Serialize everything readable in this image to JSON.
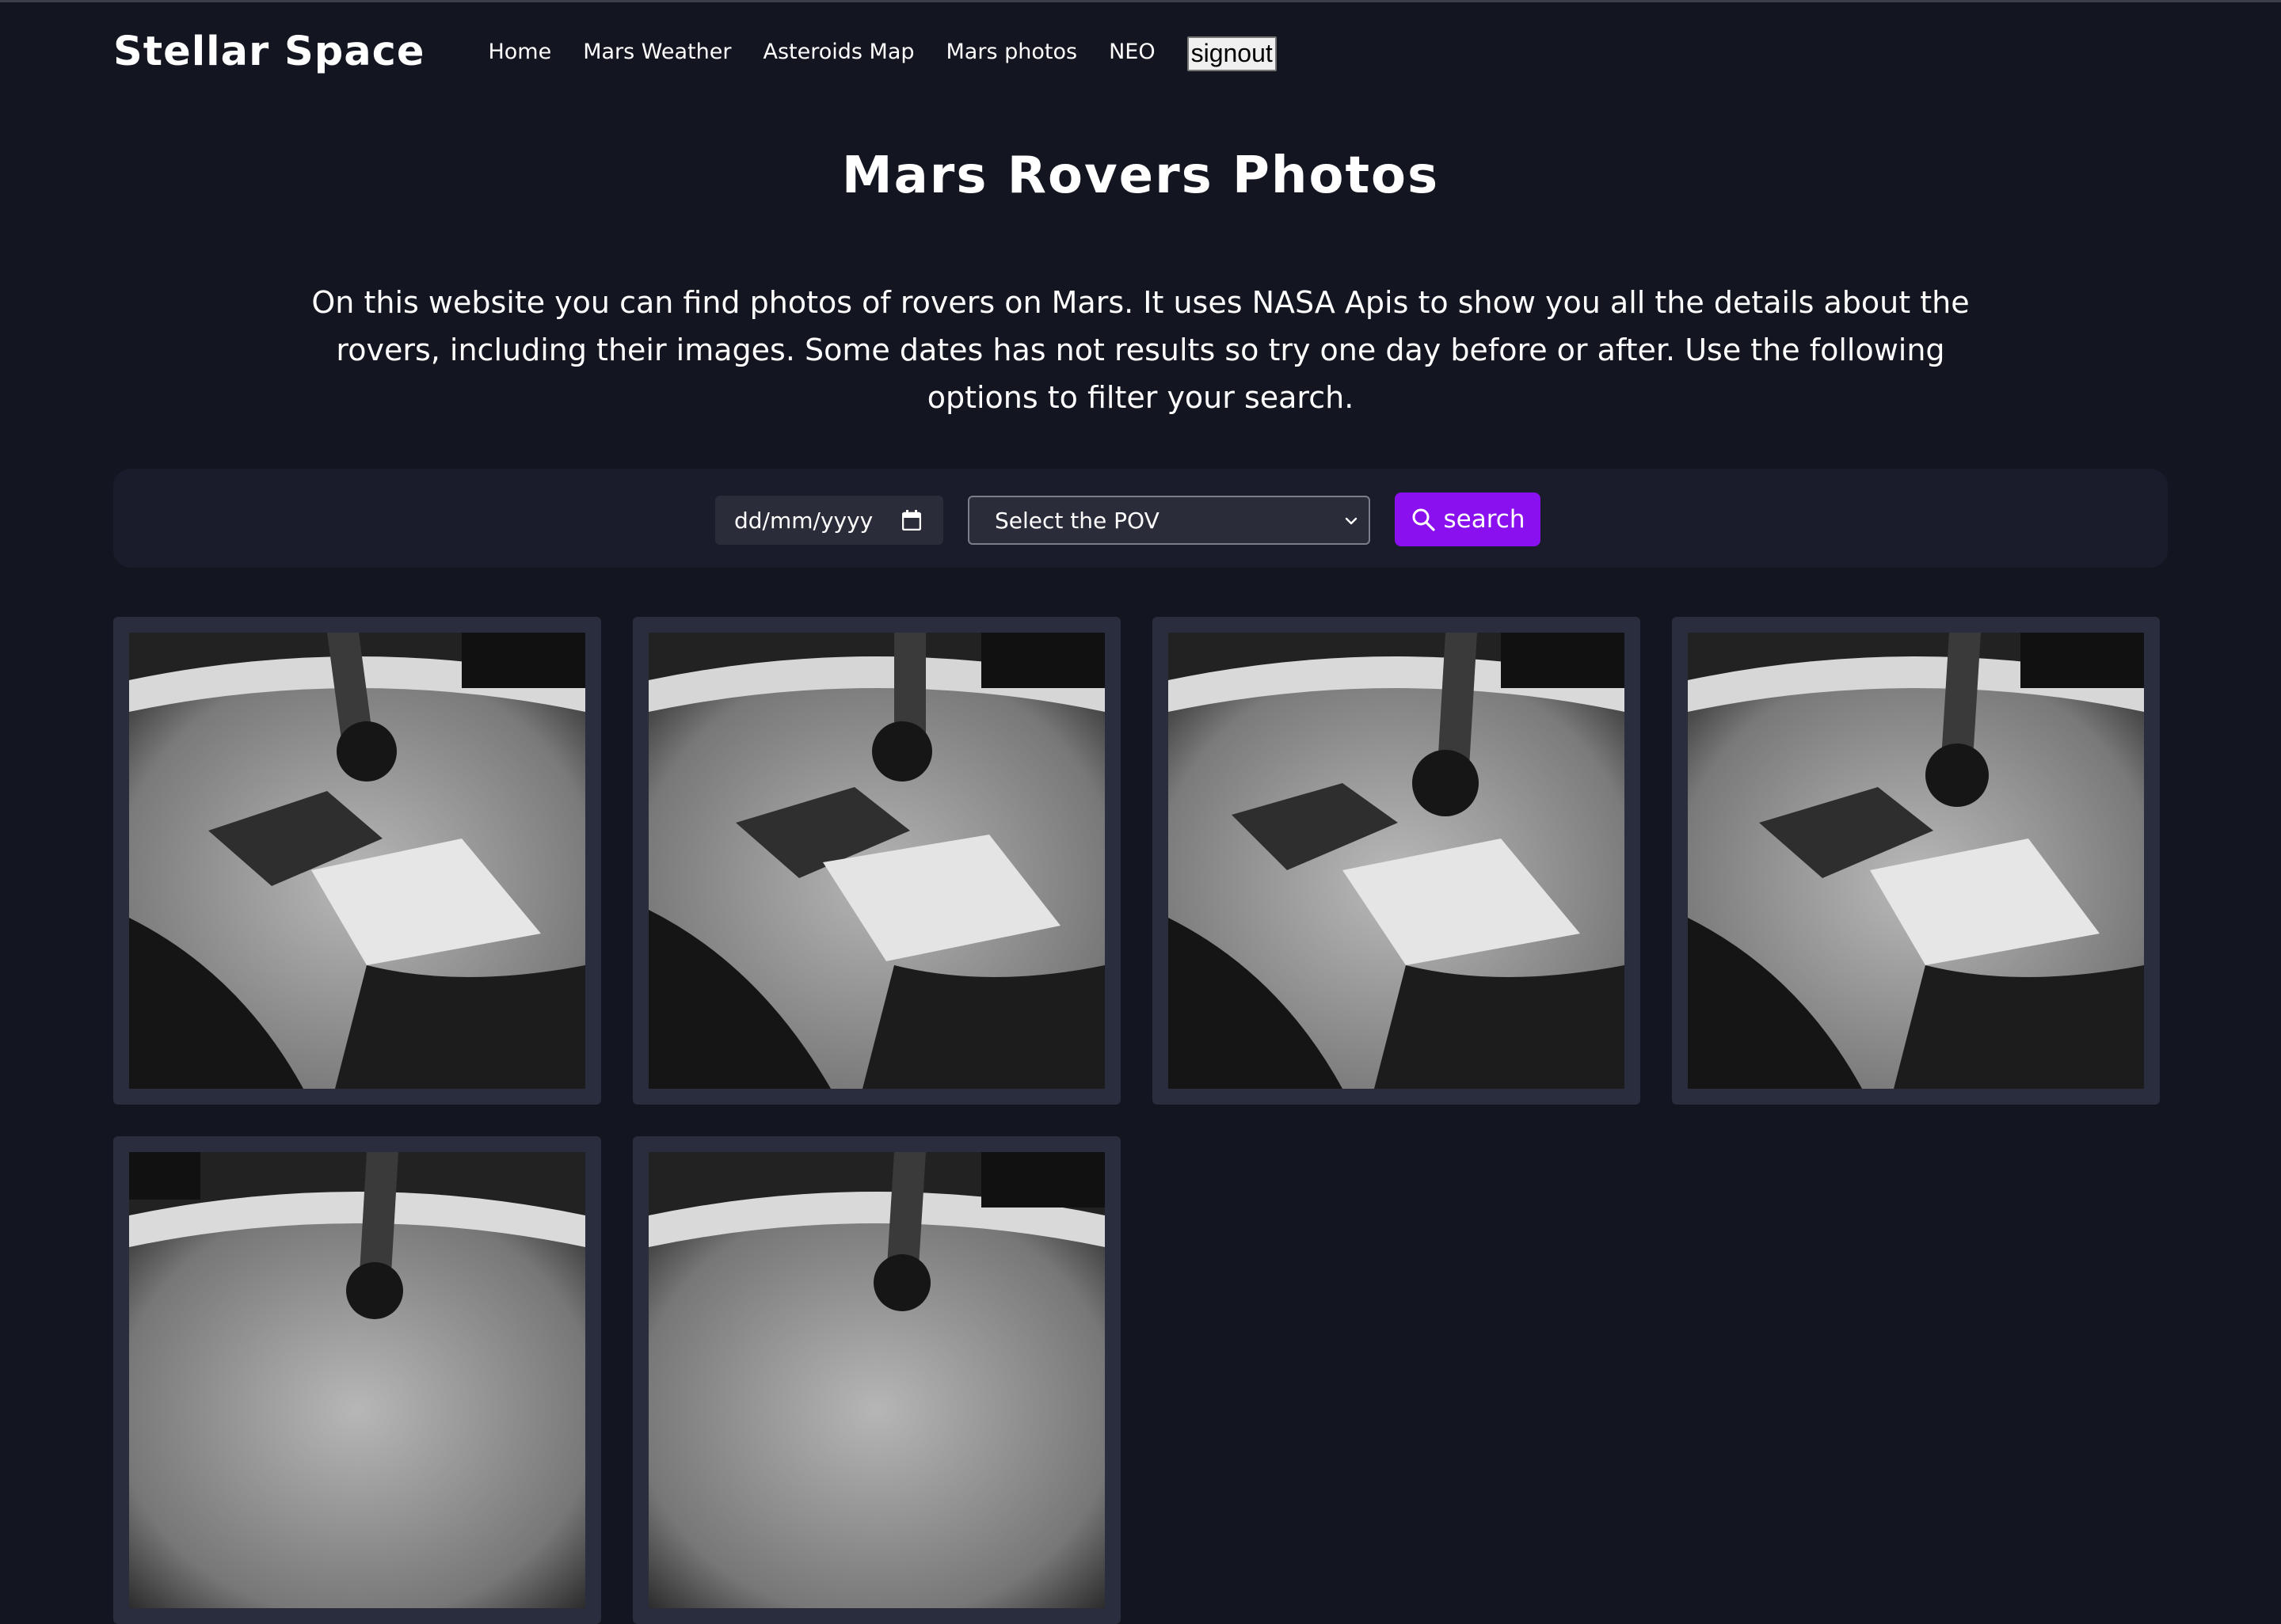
{
  "brand": "Stellar Space",
  "nav": {
    "items": [
      "Home",
      "Mars Weather",
      "Asteroids Map",
      "Mars photos",
      "NEO"
    ],
    "signout_label": "signout"
  },
  "main": {
    "title": "Mars Rovers Photos",
    "description": "On this website you can find photos of rovers on Mars. It uses NASA Apis to show you all the details about the rovers, including their images. Some dates has not results so try one day before or after. Use the following options to filter your search."
  },
  "filters": {
    "date_placeholder": "dd/mm/yyyy",
    "pov_selected": "Select the POV",
    "search_label": "search"
  },
  "photos": {
    "count": 6
  },
  "colors": {
    "background": "#131520",
    "filter_bar": "#1a1c2c",
    "accent": "#8a10f0",
    "card": "#2a2d3d"
  },
  "icons": [
    "calendar-icon",
    "chevron-down-icon",
    "search-icon"
  ]
}
